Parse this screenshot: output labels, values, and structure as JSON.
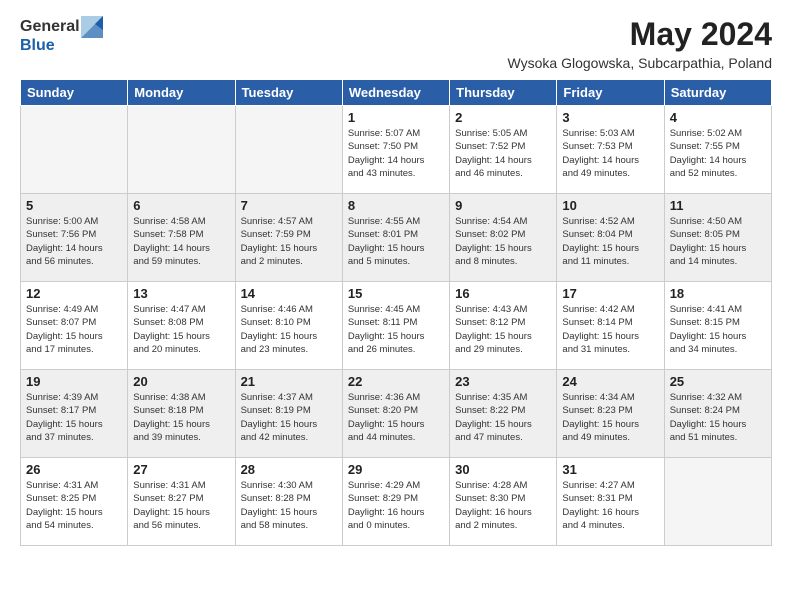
{
  "header": {
    "logo_line1": "General",
    "logo_line2": "Blue",
    "title": "May 2024",
    "subtitle": "Wysoka Glogowska, Subcarpathia, Poland"
  },
  "days_of_week": [
    "Sunday",
    "Monday",
    "Tuesday",
    "Wednesday",
    "Thursday",
    "Friday",
    "Saturday"
  ],
  "weeks": [
    {
      "shaded": false,
      "days": [
        {
          "num": "",
          "info": ""
        },
        {
          "num": "",
          "info": ""
        },
        {
          "num": "",
          "info": ""
        },
        {
          "num": "1",
          "info": "Sunrise: 5:07 AM\nSunset: 7:50 PM\nDaylight: 14 hours\nand 43 minutes."
        },
        {
          "num": "2",
          "info": "Sunrise: 5:05 AM\nSunset: 7:52 PM\nDaylight: 14 hours\nand 46 minutes."
        },
        {
          "num": "3",
          "info": "Sunrise: 5:03 AM\nSunset: 7:53 PM\nDaylight: 14 hours\nand 49 minutes."
        },
        {
          "num": "4",
          "info": "Sunrise: 5:02 AM\nSunset: 7:55 PM\nDaylight: 14 hours\nand 52 minutes."
        }
      ]
    },
    {
      "shaded": true,
      "days": [
        {
          "num": "5",
          "info": "Sunrise: 5:00 AM\nSunset: 7:56 PM\nDaylight: 14 hours\nand 56 minutes."
        },
        {
          "num": "6",
          "info": "Sunrise: 4:58 AM\nSunset: 7:58 PM\nDaylight: 14 hours\nand 59 minutes."
        },
        {
          "num": "7",
          "info": "Sunrise: 4:57 AM\nSunset: 7:59 PM\nDaylight: 15 hours\nand 2 minutes."
        },
        {
          "num": "8",
          "info": "Sunrise: 4:55 AM\nSunset: 8:01 PM\nDaylight: 15 hours\nand 5 minutes."
        },
        {
          "num": "9",
          "info": "Sunrise: 4:54 AM\nSunset: 8:02 PM\nDaylight: 15 hours\nand 8 minutes."
        },
        {
          "num": "10",
          "info": "Sunrise: 4:52 AM\nSunset: 8:04 PM\nDaylight: 15 hours\nand 11 minutes."
        },
        {
          "num": "11",
          "info": "Sunrise: 4:50 AM\nSunset: 8:05 PM\nDaylight: 15 hours\nand 14 minutes."
        }
      ]
    },
    {
      "shaded": false,
      "days": [
        {
          "num": "12",
          "info": "Sunrise: 4:49 AM\nSunset: 8:07 PM\nDaylight: 15 hours\nand 17 minutes."
        },
        {
          "num": "13",
          "info": "Sunrise: 4:47 AM\nSunset: 8:08 PM\nDaylight: 15 hours\nand 20 minutes."
        },
        {
          "num": "14",
          "info": "Sunrise: 4:46 AM\nSunset: 8:10 PM\nDaylight: 15 hours\nand 23 minutes."
        },
        {
          "num": "15",
          "info": "Sunrise: 4:45 AM\nSunset: 8:11 PM\nDaylight: 15 hours\nand 26 minutes."
        },
        {
          "num": "16",
          "info": "Sunrise: 4:43 AM\nSunset: 8:12 PM\nDaylight: 15 hours\nand 29 minutes."
        },
        {
          "num": "17",
          "info": "Sunrise: 4:42 AM\nSunset: 8:14 PM\nDaylight: 15 hours\nand 31 minutes."
        },
        {
          "num": "18",
          "info": "Sunrise: 4:41 AM\nSunset: 8:15 PM\nDaylight: 15 hours\nand 34 minutes."
        }
      ]
    },
    {
      "shaded": true,
      "days": [
        {
          "num": "19",
          "info": "Sunrise: 4:39 AM\nSunset: 8:17 PM\nDaylight: 15 hours\nand 37 minutes."
        },
        {
          "num": "20",
          "info": "Sunrise: 4:38 AM\nSunset: 8:18 PM\nDaylight: 15 hours\nand 39 minutes."
        },
        {
          "num": "21",
          "info": "Sunrise: 4:37 AM\nSunset: 8:19 PM\nDaylight: 15 hours\nand 42 minutes."
        },
        {
          "num": "22",
          "info": "Sunrise: 4:36 AM\nSunset: 8:20 PM\nDaylight: 15 hours\nand 44 minutes."
        },
        {
          "num": "23",
          "info": "Sunrise: 4:35 AM\nSunset: 8:22 PM\nDaylight: 15 hours\nand 47 minutes."
        },
        {
          "num": "24",
          "info": "Sunrise: 4:34 AM\nSunset: 8:23 PM\nDaylight: 15 hours\nand 49 minutes."
        },
        {
          "num": "25",
          "info": "Sunrise: 4:32 AM\nSunset: 8:24 PM\nDaylight: 15 hours\nand 51 minutes."
        }
      ]
    },
    {
      "shaded": false,
      "days": [
        {
          "num": "26",
          "info": "Sunrise: 4:31 AM\nSunset: 8:25 PM\nDaylight: 15 hours\nand 54 minutes."
        },
        {
          "num": "27",
          "info": "Sunrise: 4:31 AM\nSunset: 8:27 PM\nDaylight: 15 hours\nand 56 minutes."
        },
        {
          "num": "28",
          "info": "Sunrise: 4:30 AM\nSunset: 8:28 PM\nDaylight: 15 hours\nand 58 minutes."
        },
        {
          "num": "29",
          "info": "Sunrise: 4:29 AM\nSunset: 8:29 PM\nDaylight: 16 hours\nand 0 minutes."
        },
        {
          "num": "30",
          "info": "Sunrise: 4:28 AM\nSunset: 8:30 PM\nDaylight: 16 hours\nand 2 minutes."
        },
        {
          "num": "31",
          "info": "Sunrise: 4:27 AM\nSunset: 8:31 PM\nDaylight: 16 hours\nand 4 minutes."
        },
        {
          "num": "",
          "info": ""
        }
      ]
    }
  ]
}
